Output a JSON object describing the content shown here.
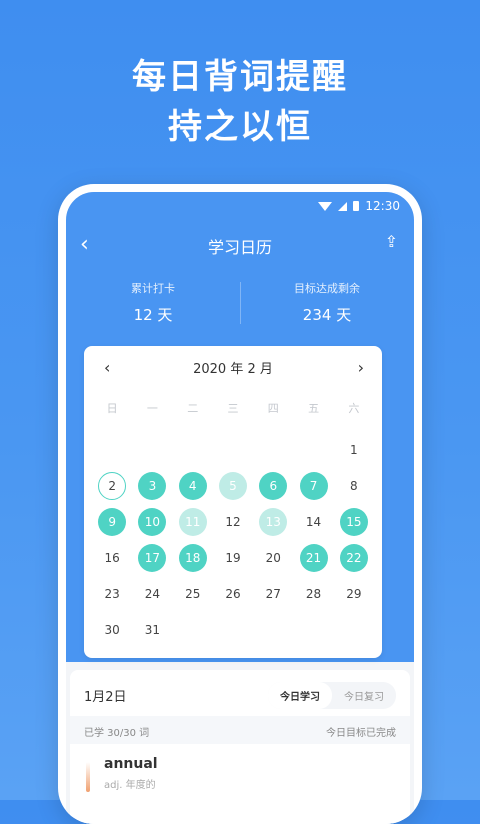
{
  "hero": {
    "line1": "每日背词提醒",
    "line2": "持之以恒"
  },
  "status": {
    "time": "12:30"
  },
  "nav": {
    "back": "‹",
    "title": "学习日历",
    "share": "⇪"
  },
  "stats": [
    {
      "label": "累计打卡",
      "value": "12 天"
    },
    {
      "label": "目标达成剩余",
      "value": "234 天"
    }
  ],
  "calendar": {
    "prev": "‹",
    "next": "›",
    "month": "2020 年 2 月",
    "weekdays": [
      "日",
      "一",
      "二",
      "三",
      "四",
      "五",
      "六"
    ],
    "lead_blanks": 6,
    "days": [
      {
        "d": "1",
        "s": ""
      },
      {
        "d": "2",
        "s": "today"
      },
      {
        "d": "3",
        "s": "done"
      },
      {
        "d": "4",
        "s": "done"
      },
      {
        "d": "5",
        "s": "light"
      },
      {
        "d": "6",
        "s": "done"
      },
      {
        "d": "7",
        "s": "done"
      },
      {
        "d": "8",
        "s": ""
      },
      {
        "d": "9",
        "s": "done"
      },
      {
        "d": "10",
        "s": "done"
      },
      {
        "d": "11",
        "s": "light"
      },
      {
        "d": "12",
        "s": ""
      },
      {
        "d": "13",
        "s": "light"
      },
      {
        "d": "14",
        "s": ""
      },
      {
        "d": "15",
        "s": "done"
      },
      {
        "d": "16",
        "s": ""
      },
      {
        "d": "17",
        "s": "done"
      },
      {
        "d": "18",
        "s": "done"
      },
      {
        "d": "19",
        "s": ""
      },
      {
        "d": "20",
        "s": ""
      },
      {
        "d": "21",
        "s": "done"
      },
      {
        "d": "22",
        "s": "done"
      },
      {
        "d": "23",
        "s": ""
      },
      {
        "d": "24",
        "s": ""
      },
      {
        "d": "25",
        "s": ""
      },
      {
        "d": "26",
        "s": ""
      },
      {
        "d": "27",
        "s": ""
      },
      {
        "d": "28",
        "s": ""
      },
      {
        "d": "29",
        "s": ""
      },
      {
        "d": "30",
        "s": ""
      },
      {
        "d": "31",
        "s": ""
      }
    ]
  },
  "daily": {
    "date": "1月2日",
    "tabs": [
      "今日学习",
      "今日复习"
    ],
    "learned": "已学 30/30 词",
    "goal_status": "今日目标已完成",
    "word": "annual",
    "meaning": "adj. 年度的"
  },
  "colors": {
    "bg": "#4995f2",
    "done": "#4fd3c4",
    "light": "#bfece6"
  }
}
